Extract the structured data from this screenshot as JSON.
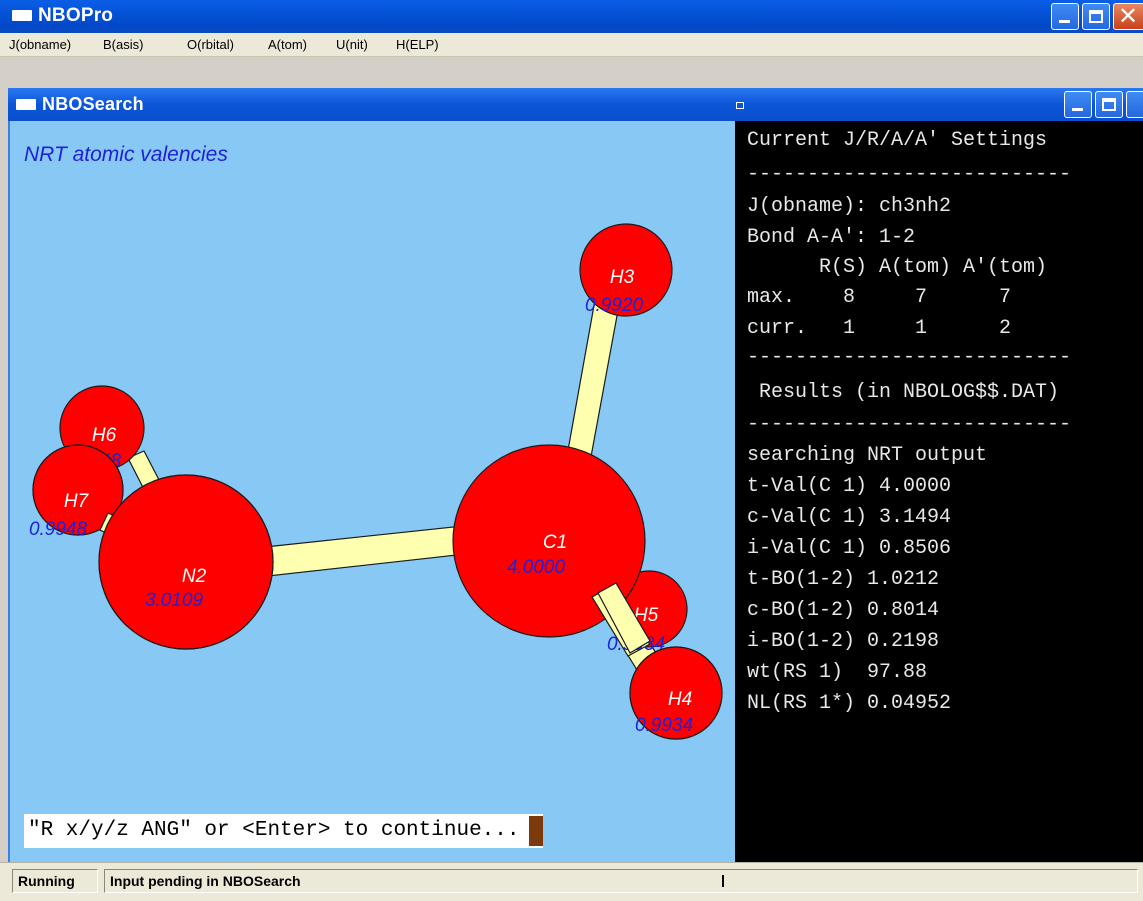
{
  "app": {
    "title": "NBOPro"
  },
  "menu": [
    {
      "label": "J(obname)"
    },
    {
      "label": "B(asis)"
    },
    {
      "label": "O(rbital)"
    },
    {
      "label": "A(tom)"
    },
    {
      "label": "U(nit)"
    },
    {
      "label": "H(ELP)"
    }
  ],
  "child_window": {
    "title": "NBOSearch"
  },
  "graphics": {
    "caption": "NRT atomic valencies",
    "prompt": "\"R x/y/z ANG\" or <Enter> to continue...",
    "colors": {
      "background": "#87c8f5",
      "atom": "#ff0000",
      "bond": "#ffffb0",
      "label_value": "#2121d6"
    },
    "atoms": [
      {
        "name": "H3",
        "value": "0.9920"
      },
      {
        "name": "H6",
        "value": "0.9948"
      },
      {
        "name": "H7",
        "value": "0.9948"
      },
      {
        "name": "N2",
        "value": "3.0109"
      },
      {
        "name": "C1",
        "value": "4.0000"
      },
      {
        "name": "H5",
        "value": "0.9934"
      },
      {
        "name": "H4",
        "value": "0.9934"
      }
    ]
  },
  "terminal": {
    "lines": [
      "Current J/R/A/A' Settings",
      "---------------------------",
      "J(obname): ch3nh2",
      "Bond A-A': 1-2",
      "      R(S) A(tom) A'(tom)",
      "max.    8     7      7",
      "curr.   1     1      2",
      "---------------------------",
      " Results (in NBOLOG$$.DAT)",
      "---------------------------",
      "searching NRT output",
      "t-Val(C 1) 4.0000",
      "c-Val(C 1) 3.1494",
      "i-Val(C 1) 0.8506",
      "t-BO(1-2) 1.0212",
      "c-BO(1-2) 0.8014",
      "i-BO(1-2) 0.2198",
      "wt(RS 1)  97.88",
      "NL(RS 1*) 0.04952"
    ]
  },
  "status": {
    "state": "Running",
    "message": "Input pending in NBOSearch"
  }
}
